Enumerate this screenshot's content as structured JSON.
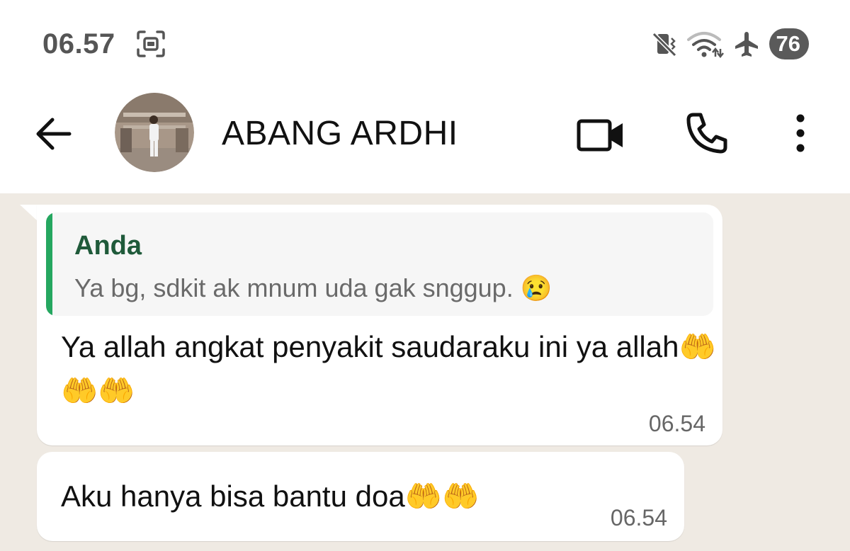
{
  "status_bar": {
    "time": "06.57",
    "battery": "76"
  },
  "header": {
    "contact_name": "ABANG ARDHI"
  },
  "messages": [
    {
      "quote": {
        "author": "Anda",
        "text": "Ya bg, sdkit ak mnum uda gak snggup. 😢"
      },
      "text": "Ya allah angkat penyakit saudaraku ini ya allah🤲🤲🤲",
      "time": "06.54"
    },
    {
      "text": "Aku hanya bisa bantu doa🤲🤲",
      "time": "06.54"
    }
  ],
  "icons": {
    "back": "arrow-left-icon",
    "video": "video-call-icon",
    "call": "phone-icon",
    "menu": "more-vertical-icon",
    "screenshot": "screenshot-icon",
    "mute": "vibrate-mute-icon",
    "wifi": "wifi-icon",
    "airplane": "airplane-icon"
  },
  "colors": {
    "chat_background": "#efeae3",
    "quote_bar": "#25a760",
    "quote_author": "#1f5a3a"
  }
}
